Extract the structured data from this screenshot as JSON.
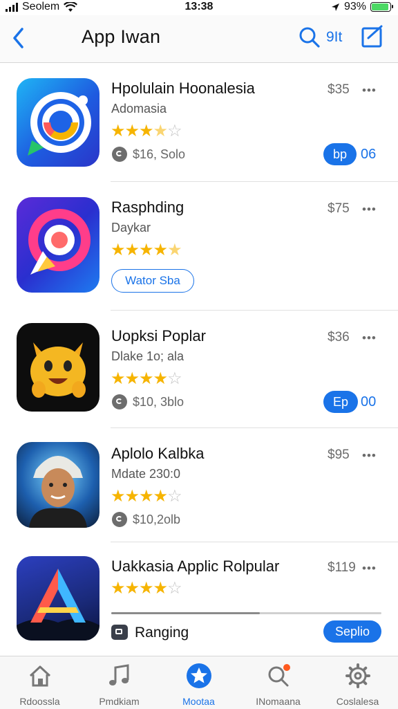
{
  "status_bar": {
    "carrier": "Seolem",
    "time": "13:38",
    "battery": "93%",
    "battery_level": 0.93
  },
  "nav": {
    "title": "App Iwan",
    "sort_label": "9It"
  },
  "apps": [
    {
      "name": "Hpolulain Hoonalesia",
      "subtitle": "Adomasia",
      "rating": 3.5,
      "price": "$35",
      "more": "•••",
      "meta": "$16, Solo",
      "action_label": "bp",
      "action_count": "06"
    },
    {
      "name": "Rasphding",
      "subtitle": "Daykar",
      "rating": 4.5,
      "price": "$75",
      "more": "•••",
      "action_label": "Wator Sba"
    },
    {
      "name": "Uopksi Poplar",
      "subtitle": "Dlake 1o; ala",
      "rating": 4,
      "price": "$36",
      "more": "•••",
      "meta": "$10, 3blo",
      "action_label": "Ep",
      "action_count": "00"
    },
    {
      "name": "Aplolo Kalbka",
      "subtitle": "Mdate 230:0",
      "rating": 4,
      "price": "$95",
      "more": "•••",
      "meta": "$10,2olb"
    },
    {
      "name": "Uakkasia Applic Rolpular",
      "rating": 4,
      "price": "$119",
      "more": "•••",
      "progress": 0.55,
      "rank_label": "Ranging",
      "action_label": "Seplio"
    }
  ],
  "tabs": [
    {
      "label": "Rdoossla",
      "icon": "home-icon"
    },
    {
      "label": "Pmdkiam",
      "icon": "music-icon"
    },
    {
      "label": "Mootaa",
      "icon": "star-icon",
      "active": true
    },
    {
      "label": "INomaana",
      "icon": "search-icon"
    },
    {
      "label": "Coslalesa",
      "icon": "gear-icon"
    }
  ],
  "colors": {
    "accent": "#1a73e8",
    "star": "#f6b400",
    "battery": "#4cd964",
    "notification": "#ff5a1f"
  }
}
